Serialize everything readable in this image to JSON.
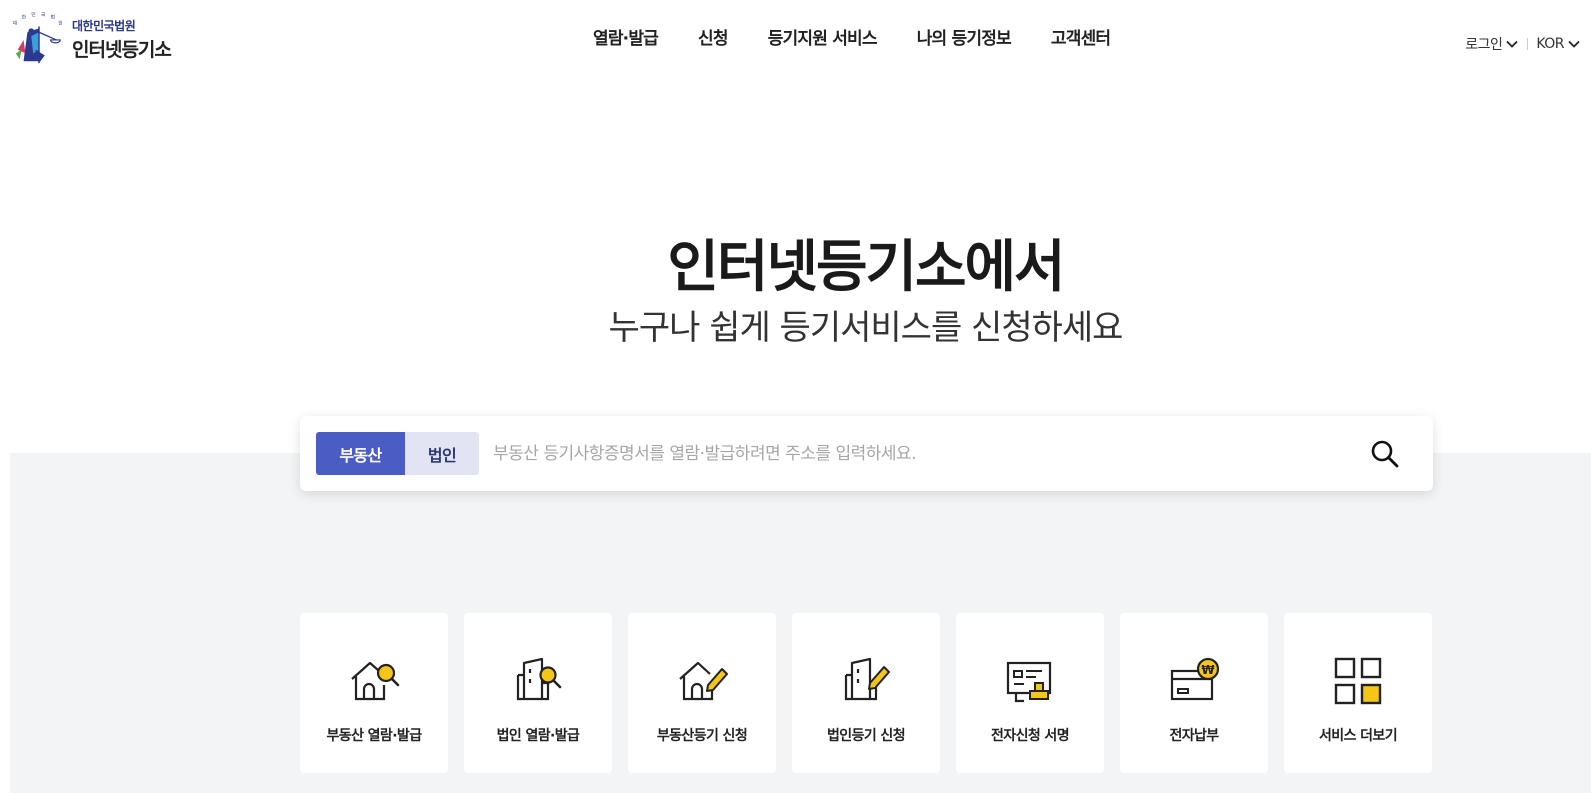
{
  "logo": {
    "sub": "대한민국법원",
    "main": "인터넷등기소"
  },
  "gnb": [
    "열람·발급",
    "신청",
    "등기지원 서비스",
    "나의 등기정보",
    "고객센터"
  ],
  "util": {
    "login": "로그인",
    "lang": "KOR"
  },
  "hero": {
    "title": "인터넷등기소에서",
    "subtitle": "누구나 쉽게 등기서비스를 신청하세요"
  },
  "search": {
    "tab_active": "부동산",
    "tab_inactive": "법인",
    "placeholder": "부동산 등기사항증명서를 열람·발급하려면 주소를 입력하세요."
  },
  "services": [
    {
      "label": "부동산 열람·발급",
      "icon": "house-search-icon"
    },
    {
      "label": "법인 열람·발급",
      "icon": "building-search-icon"
    },
    {
      "label": "부동산등기 신청",
      "icon": "house-pen-icon"
    },
    {
      "label": "법인등기 신청",
      "icon": "building-pen-icon"
    },
    {
      "label": "전자신청 서명",
      "icon": "e-sign-icon"
    },
    {
      "label": "전자납부",
      "icon": "e-payment-icon"
    },
    {
      "label": "서비스 더보기",
      "icon": "grid-more-icon"
    }
  ],
  "colors": {
    "accent": "#4b5cc4",
    "accent_light": "#e2e4f4",
    "icon_highlight": "#f5c518",
    "band": "#f3f4f6"
  }
}
